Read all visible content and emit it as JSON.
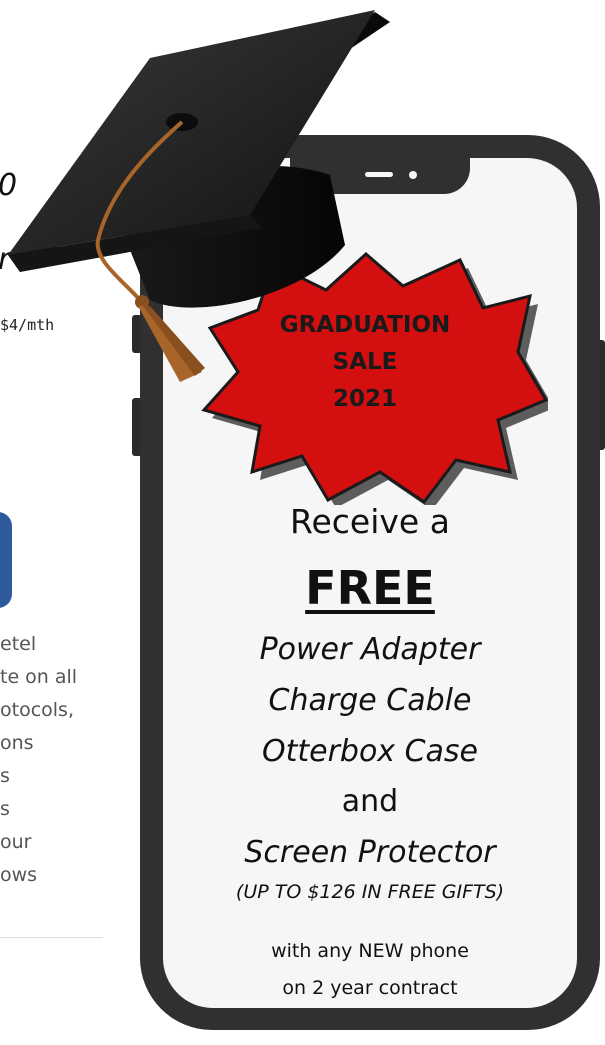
{
  "background": {
    "fragment_zero": "0",
    "fragment_r": "r",
    "fragment_price": "$4/mth",
    "text_lines": [
      "etel",
      "te on all",
      "otocols,",
      "ons",
      "s",
      "s",
      "our",
      "ows"
    ]
  },
  "ad": {
    "badge": {
      "line1": "GRADUATION",
      "line2": "SALE",
      "line3": "2021"
    },
    "receive": "Receive a",
    "free": "FREE",
    "items": [
      "Power Adapter",
      "Charge Cable",
      "Otterbox Case"
    ],
    "and": "and",
    "last_item": "Screen Protector",
    "gifts_note": "(UP TO $126 IN FREE GIFTS)",
    "footer_line1": "with any NEW phone",
    "footer_line2": "on 2 year contract"
  },
  "colors": {
    "badge_red": "#d40f0f",
    "phone_body": "#303030",
    "screen": "#f6f6f6",
    "tassel": "#a8652a",
    "bg_blue_tile": "#2f5b9e"
  },
  "icons": {
    "cap": "graduation-cap-icon",
    "badge": "starburst-badge-icon"
  }
}
